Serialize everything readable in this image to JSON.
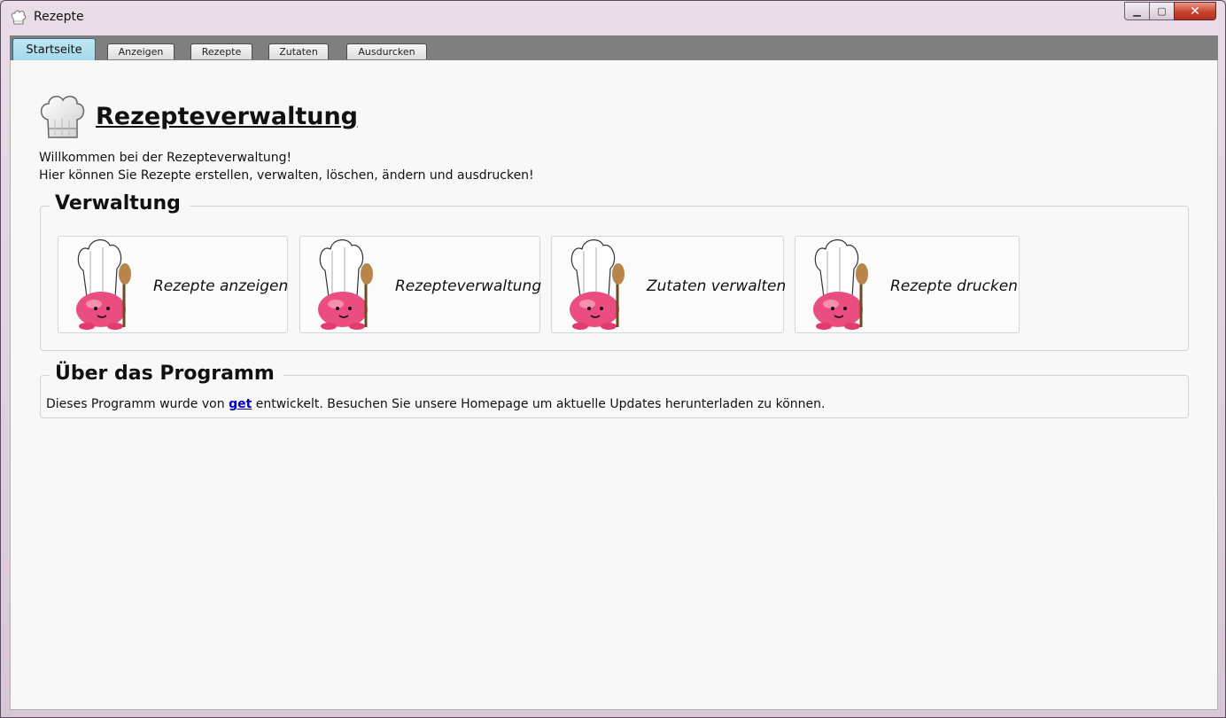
{
  "window": {
    "title": "Rezepte",
    "controls": {
      "minimize": "▁",
      "maximize": "▢",
      "close": "✕"
    }
  },
  "tabs": [
    {
      "label": "Startseite",
      "active": true
    },
    {
      "label": "Anzeigen",
      "active": false
    },
    {
      "label": "Rezepte",
      "active": false
    },
    {
      "label": "Zutaten",
      "active": false
    },
    {
      "label": "Ausdurcken",
      "active": false
    }
  ],
  "header": {
    "title": "Rezepteverwaltung",
    "welcome_line1": "Willkommen bei der Rezepteverwaltung!",
    "welcome_line2": "Hier können Sie Rezepte erstellen, verwalten, löschen, ändern und ausdrucken!"
  },
  "verwaltung": {
    "legend": "Verwaltung",
    "cards": [
      {
        "label": "Rezepte anzeigen",
        "icon": "chef-mascot-icon"
      },
      {
        "label": "Rezepteverwaltung",
        "icon": "chef-mascot-icon"
      },
      {
        "label": "Zutaten verwalten",
        "icon": "chef-mascot-icon"
      },
      {
        "label": "Rezepte drucken",
        "icon": "chef-mascot-icon"
      }
    ]
  },
  "about": {
    "legend": "Über das Programm",
    "text_before": "Dieses Programm wurde von ",
    "link": "get",
    "text_after": " entwickelt. Besuchen Sie unsere Homepage um aktuelle Updates herunterladen zu können."
  },
  "colors": {
    "active_tab": "#a6d8ea",
    "tabstrip": "#7f7f7f",
    "mascot_pink": "#e8467a",
    "link": "#0000cc"
  }
}
